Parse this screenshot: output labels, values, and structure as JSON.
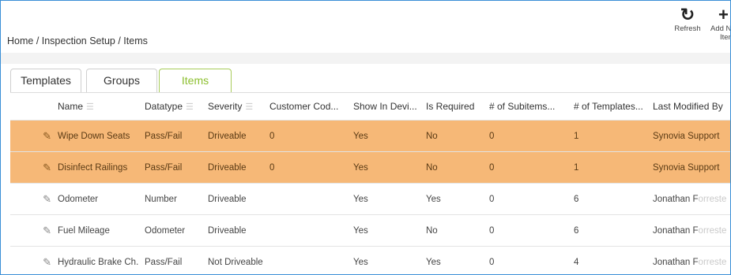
{
  "toolbar": {
    "refresh_label": "Refresh",
    "add_label_line1": "Add N",
    "add_label_line2": "Iten"
  },
  "breadcrumb": "Home / Inspection Setup / Items",
  "tabs": [
    {
      "label": "Templates"
    },
    {
      "label": "Groups"
    },
    {
      "label": "Items"
    }
  ],
  "table": {
    "headers": [
      "Name",
      "Datatype",
      "Severity",
      "Customer Cod...",
      "Show In Devi...",
      "Is Required",
      "# of Subitems...",
      "# of Templates...",
      "Last Modified By"
    ],
    "rows": [
      {
        "highlighted": true,
        "name": "Wipe Down Seats",
        "datatype": "Pass/Fail",
        "severity": "Driveable",
        "customer_code": "0",
        "show_in_device": "Yes",
        "is_required": "No",
        "subitems": "0",
        "templates": "1",
        "last_modified_by": "Synovia Support",
        "fade": ""
      },
      {
        "highlighted": true,
        "name": "Disinfect Railings",
        "datatype": "Pass/Fail",
        "severity": "Driveable",
        "customer_code": "0",
        "show_in_device": "Yes",
        "is_required": "No",
        "subitems": "0",
        "templates": "1",
        "last_modified_by": "Synovia Support",
        "fade": ""
      },
      {
        "highlighted": false,
        "name": "Odometer",
        "datatype": "Number",
        "severity": "Driveable",
        "customer_code": "",
        "show_in_device": "Yes",
        "is_required": "Yes",
        "subitems": "0",
        "templates": "6",
        "last_modified_by": "Jonathan F",
        "fade": "orreste"
      },
      {
        "highlighted": false,
        "name": "Fuel Mileage",
        "datatype": "Odometer",
        "severity": "Driveable",
        "customer_code": "",
        "show_in_device": "Yes",
        "is_required": "No",
        "subitems": "0",
        "templates": "6",
        "last_modified_by": "Jonathan F",
        "fade": "orreste"
      },
      {
        "highlighted": false,
        "name": "Hydraulic Brake Ch...",
        "datatype": "Pass/Fail",
        "severity": "Not Driveable",
        "customer_code": "",
        "show_in_device": "Yes",
        "is_required": "Yes",
        "subitems": "0",
        "templates": "4",
        "last_modified_by": "Jonathan F",
        "fade": "orreste"
      }
    ]
  }
}
